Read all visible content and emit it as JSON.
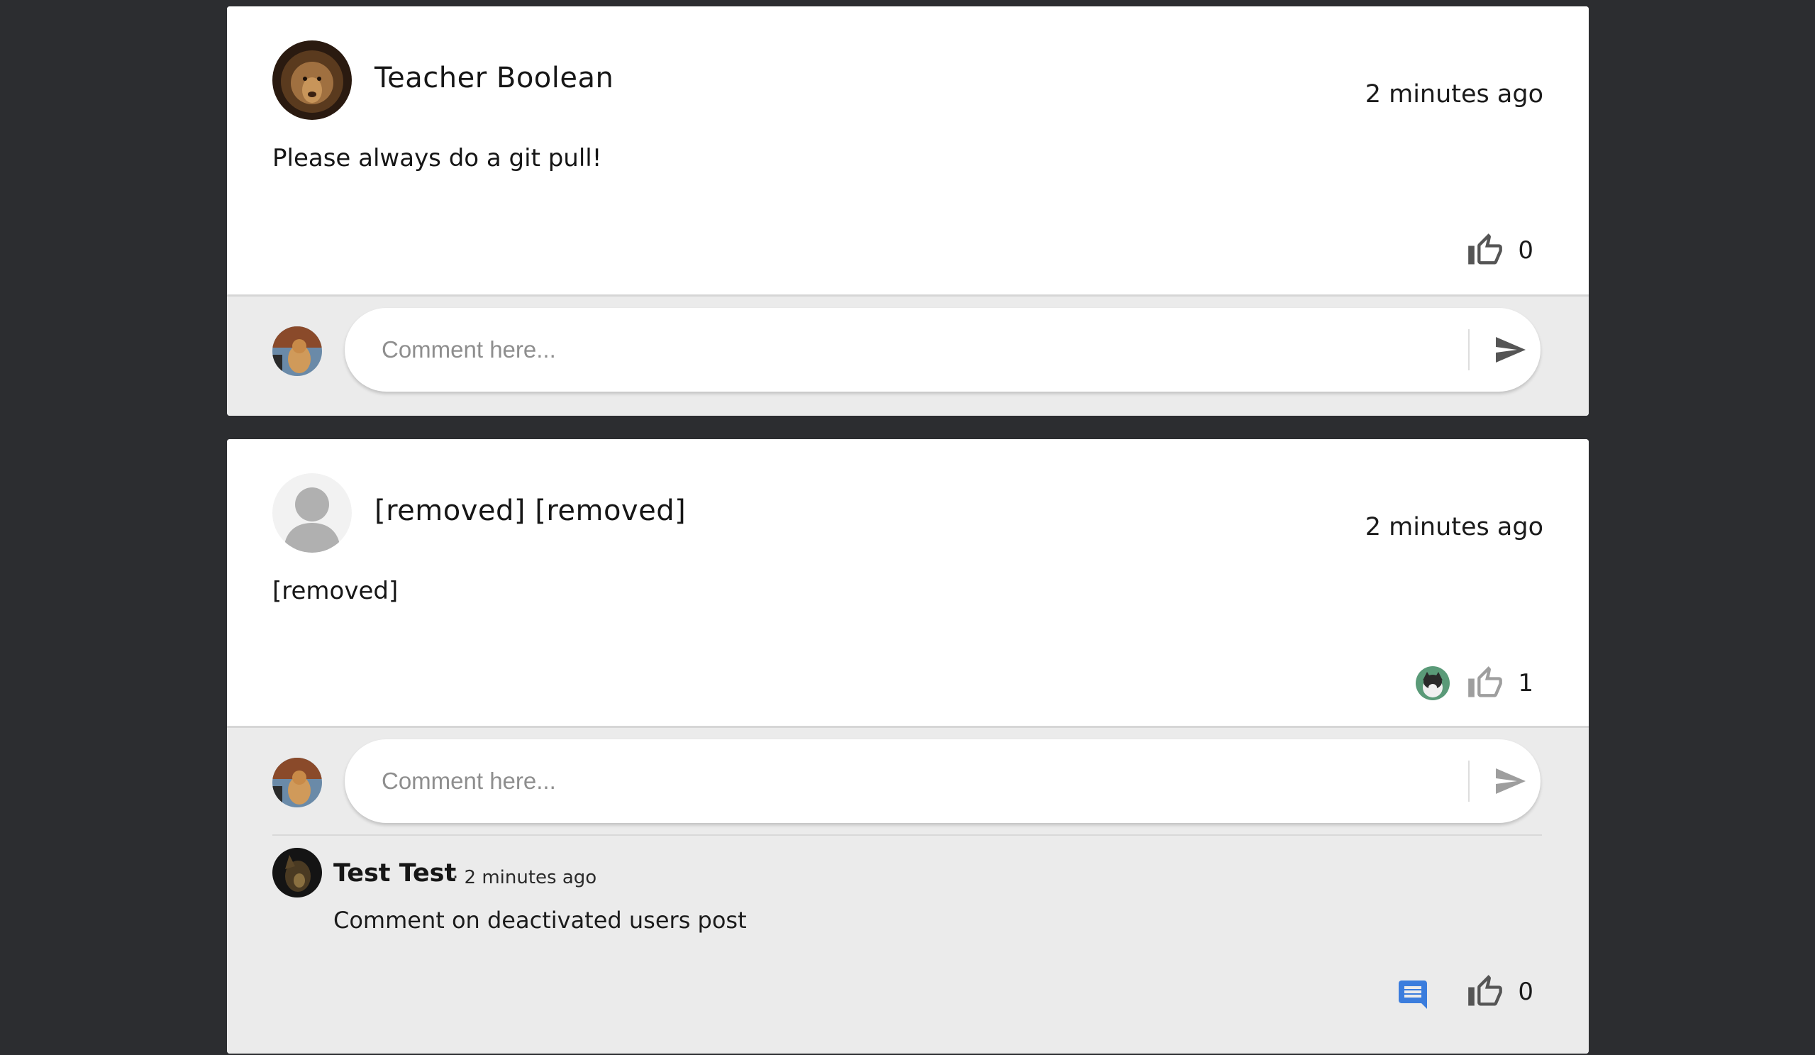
{
  "posts": [
    {
      "author": "Teacher Boolean",
      "time": "2 minutes ago",
      "text": "Please always do a git pull!",
      "likes": "0",
      "liked_by_me": false,
      "comment_placeholder": "Comment here...",
      "comments": []
    },
    {
      "author": "[removed] [removed]",
      "time": "2 minutes ago",
      "text": "[removed]",
      "likes": "1",
      "liked_by_me": false,
      "comment_placeholder": "Comment here...",
      "comments": [
        {
          "author": "Test Test",
          "time": "· 2 minutes ago",
          "text": "Comment on deactivated users post",
          "likes": "0"
        }
      ]
    }
  ],
  "colors": {
    "page_background": "#2c2d30",
    "card_background": "#ffffff",
    "comment_background": "#ebebeb",
    "reply_icon": "#3b7ddd",
    "icon_gray": "#555555",
    "icon_light_gray": "#9e9e9e"
  },
  "icons": {
    "like": "thumbs-up-icon",
    "send": "send-icon",
    "reply": "comment-icon"
  }
}
